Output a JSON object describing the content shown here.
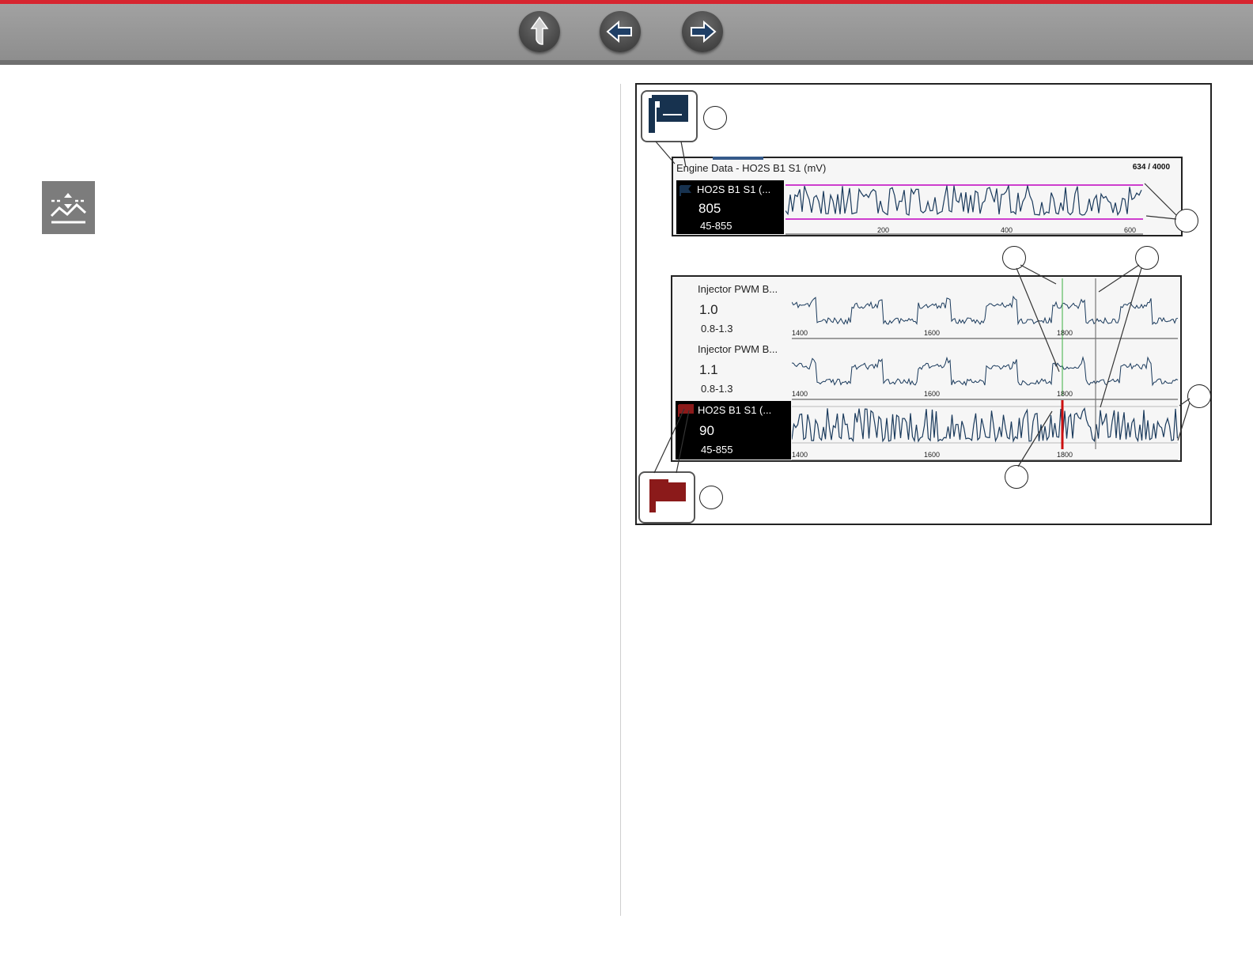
{
  "nav": {
    "buttons": [
      {
        "name": "home",
        "icon": "up-arrow-icon"
      },
      {
        "name": "back",
        "icon": "left-arrow-icon"
      },
      {
        "name": "forward",
        "icon": "right-arrow-icon"
      }
    ]
  },
  "colors": {
    "accent_red": "#d7252f",
    "trace_blue": "#1a3a5c",
    "limit_magenta": "#c000c0",
    "flag_blue": "#17324f",
    "flag_red": "#8b1a1a",
    "cursor_red": "#cc1010",
    "cursor_green": "#3cb043"
  },
  "figure": {
    "top_panel": {
      "title": "Engine Data - HO2S B1 S1 (mV)",
      "counter": "634 / 4000",
      "param_name": "HO2S B1 S1 (...",
      "value": "805",
      "range": "45-855",
      "ticks": [
        "200",
        "400",
        "600"
      ]
    },
    "bottom_panel": {
      "rows": [
        {
          "name": "Injector PWM B...",
          "value": "1.0",
          "range": "0.8-1.3",
          "ticks": [
            "1400",
            "1600",
            "1800"
          ]
        },
        {
          "name": "Injector PWM B...",
          "value": "1.1",
          "range": "0.8-1.3",
          "ticks": [
            "1400",
            "1600",
            "1800"
          ]
        },
        {
          "name": "HO2S B1 S1 (...",
          "value": "90",
          "range": "45-855",
          "ticks": [
            "1400",
            "1600",
            "1800"
          ]
        }
      ]
    }
  }
}
